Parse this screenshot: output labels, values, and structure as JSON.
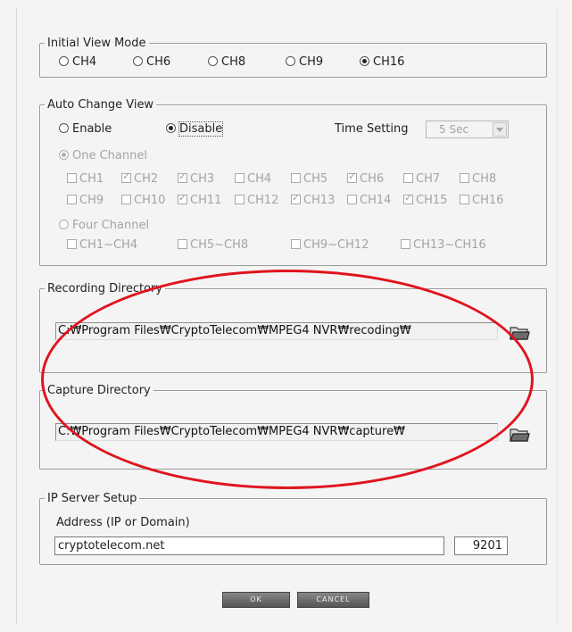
{
  "initial_view_mode": {
    "title": "Initial View Mode",
    "options": [
      "CH4",
      "CH6",
      "CH8",
      "CH9",
      "CH16"
    ],
    "selected": "CH16"
  },
  "auto_change_view": {
    "title": "Auto Change View",
    "enable_label": "Enable",
    "disable_label": "Disable",
    "selected": "Disable",
    "time_setting_label": "Time Setting",
    "time_setting_value": "5 Sec",
    "one_channel_label": "One Channel",
    "channels": [
      {
        "label": "CH1",
        "checked": false
      },
      {
        "label": "CH2",
        "checked": true
      },
      {
        "label": "CH3",
        "checked": true
      },
      {
        "label": "CH4",
        "checked": false
      },
      {
        "label": "CH5",
        "checked": false
      },
      {
        "label": "CH6",
        "checked": true
      },
      {
        "label": "CH7",
        "checked": false
      },
      {
        "label": "CH8",
        "checked": false
      },
      {
        "label": "CH9",
        "checked": false
      },
      {
        "label": "CH10",
        "checked": false
      },
      {
        "label": "CH11",
        "checked": true
      },
      {
        "label": "CH12",
        "checked": false
      },
      {
        "label": "CH13",
        "checked": true
      },
      {
        "label": "CH14",
        "checked": false
      },
      {
        "label": "CH15",
        "checked": true
      },
      {
        "label": "CH16",
        "checked": false
      }
    ],
    "four_channel_label": "Four Channel",
    "four_channel_groups": [
      {
        "label": "CH1~CH4",
        "checked": false
      },
      {
        "label": "CH5~CH8",
        "checked": false
      },
      {
        "label": "CH9~CH12",
        "checked": false
      },
      {
        "label": "CH13~CH16",
        "checked": false
      }
    ]
  },
  "recording_directory": {
    "title": "Recording Directory",
    "path": "C:₩Program Files₩CryptoTelecom₩MPEG4 NVR₩recoding₩"
  },
  "capture_directory": {
    "title": "Capture Directory",
    "path": "C:₩Program Files₩CryptoTelecom₩MPEG4 NVR₩capture₩"
  },
  "ip_server": {
    "title": "IP Server Setup",
    "address_label": "Address (IP or Domain)",
    "address_value": "cryptotelecom.net",
    "port_value": "9201"
  },
  "buttons": {
    "ok": "OK",
    "cancel": "CANCEL"
  },
  "colors": {
    "annotation": "#e0141e",
    "background": "#f4f4f4"
  }
}
